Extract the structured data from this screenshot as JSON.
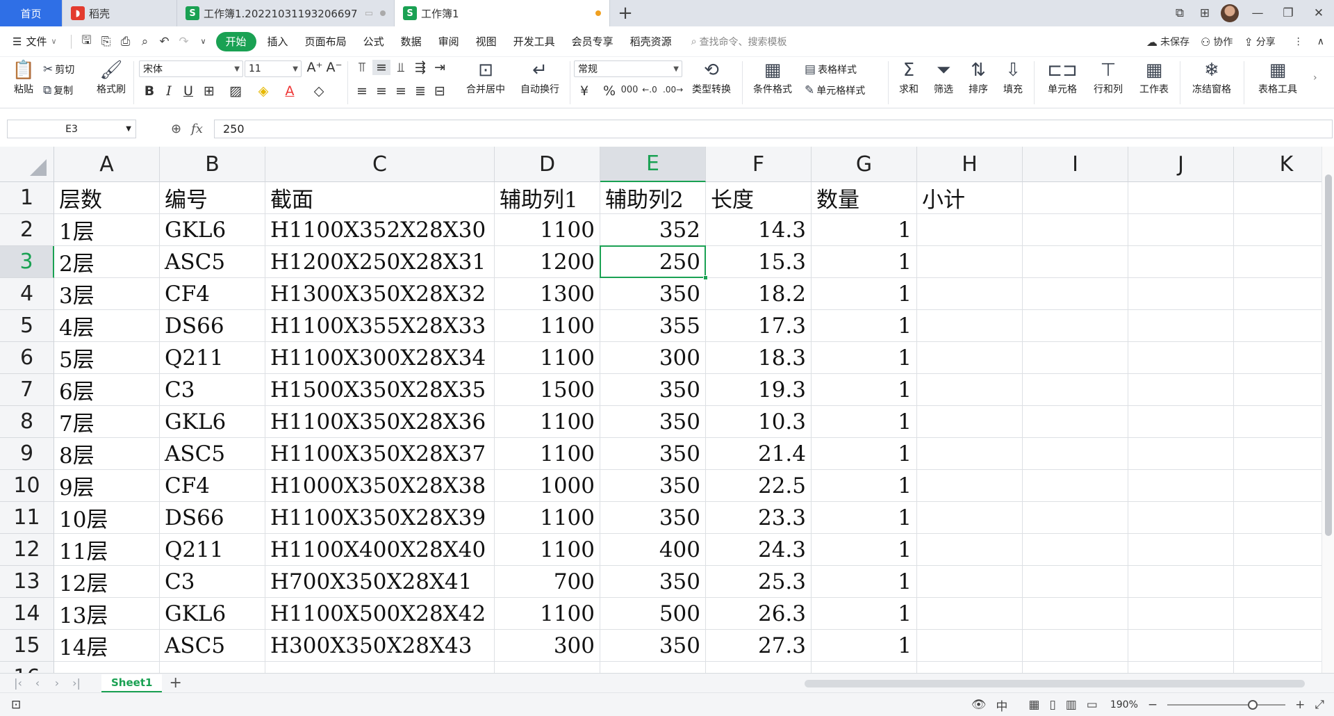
{
  "tabs": {
    "home": "首页",
    "docshell": "稻壳",
    "workbook1": "工作簿1.20221031193206697",
    "workbook": "工作簿1",
    "add": "+"
  },
  "menu": {
    "file": "文件",
    "items": [
      "开始",
      "插入",
      "页面布局",
      "公式",
      "数据",
      "审阅",
      "视图",
      "开发工具",
      "会员专享",
      "稻壳资源"
    ],
    "search_placeholder": "查找命令、搜索模板",
    "unsaved": "未保存",
    "collab": "协作",
    "share": "分享"
  },
  "ribbon": {
    "paste": "粘贴",
    "cut": "剪切",
    "copy": "复制",
    "format_painter": "格式刷",
    "font_name": "宋体",
    "font_size": "11",
    "merge_center": "合并居中",
    "wrap_text": "自动换行",
    "number_format": "常规",
    "type_convert": "类型转换",
    "cond_format": "条件格式",
    "table_style": "表格样式",
    "cell_style": "单元格样式",
    "sum": "求和",
    "filter": "筛选",
    "sort": "排序",
    "fill": "填充",
    "cell": "单元格",
    "row_col": "行和列",
    "worksheet": "工作表",
    "freeze": "冻结窗格",
    "table_tools": "表格工具",
    "bold": "B",
    "italic": "I",
    "underline": "U",
    "font_color": "A",
    "currency": "¥",
    "percent": "%",
    "thousands": "000"
  },
  "formula_bar": {
    "cell_ref": "E3",
    "fx": "fx",
    "value": "250"
  },
  "sheet": {
    "columns": [
      "A",
      "B",
      "C",
      "D",
      "E",
      "F",
      "G",
      "H",
      "I",
      "J",
      "K"
    ],
    "selected_col": "E",
    "selected_row": 3,
    "rows": [
      [
        "层数",
        "编号",
        "截面",
        "辅助列1",
        "辅助列2",
        "长度",
        "数量",
        "小计",
        "",
        "",
        ""
      ],
      [
        "1层",
        "GKL6",
        "H1100X352X28X30",
        "1100",
        "352",
        "14.3",
        "1",
        "",
        "",
        "",
        ""
      ],
      [
        "2层",
        "ASC5",
        "H1200X250X28X31",
        "1200",
        "250",
        "15.3",
        "1",
        "",
        "",
        "",
        ""
      ],
      [
        "3层",
        "CF4",
        "H1300X350X28X32",
        "1300",
        "350",
        "18.2",
        "1",
        "",
        "",
        "",
        ""
      ],
      [
        "4层",
        "DS66",
        "H1100X355X28X33",
        "1100",
        "355",
        "17.3",
        "1",
        "",
        "",
        "",
        ""
      ],
      [
        "5层",
        "Q211",
        "H1100X300X28X34",
        "1100",
        "300",
        "18.3",
        "1",
        "",
        "",
        "",
        ""
      ],
      [
        "6层",
        "C3",
        "H1500X350X28X35",
        "1500",
        "350",
        "19.3",
        "1",
        "",
        "",
        "",
        ""
      ],
      [
        "7层",
        "GKL6",
        "H1100X350X28X36",
        "1100",
        "350",
        "10.3",
        "1",
        "",
        "",
        "",
        ""
      ],
      [
        "8层",
        "ASC5",
        "H1100X350X28X37",
        "1100",
        "350",
        "21.4",
        "1",
        "",
        "",
        "",
        ""
      ],
      [
        "9层",
        "CF4",
        "H1000X350X28X38",
        "1000",
        "350",
        "22.5",
        "1",
        "",
        "",
        "",
        ""
      ],
      [
        "10层",
        "DS66",
        "H1100X350X28X39",
        "1100",
        "350",
        "23.3",
        "1",
        "",
        "",
        "",
        ""
      ],
      [
        "11层",
        "Q211",
        "H1100X400X28X40",
        "1100",
        "400",
        "24.3",
        "1",
        "",
        "",
        "",
        ""
      ],
      [
        "12层",
        "C3",
        "H700X350X28X41",
        "700",
        "350",
        "25.3",
        "1",
        "",
        "",
        "",
        ""
      ],
      [
        "13层",
        "GKL6",
        "H1100X500X28X42",
        "1100",
        "500",
        "26.3",
        "1",
        "",
        "",
        "",
        ""
      ],
      [
        "14层",
        "ASC5",
        "H300X350X28X43",
        "300",
        "350",
        "27.3",
        "1",
        "",
        "",
        "",
        ""
      ]
    ]
  },
  "sheetbar": {
    "sheet_name": "Sheet1"
  },
  "status": {
    "zoom": "190%",
    "zoom_level": 0.72,
    "input_mode": "中"
  },
  "colors": {
    "accent": "#1aa153",
    "home_tab": "#2f6fe6"
  }
}
